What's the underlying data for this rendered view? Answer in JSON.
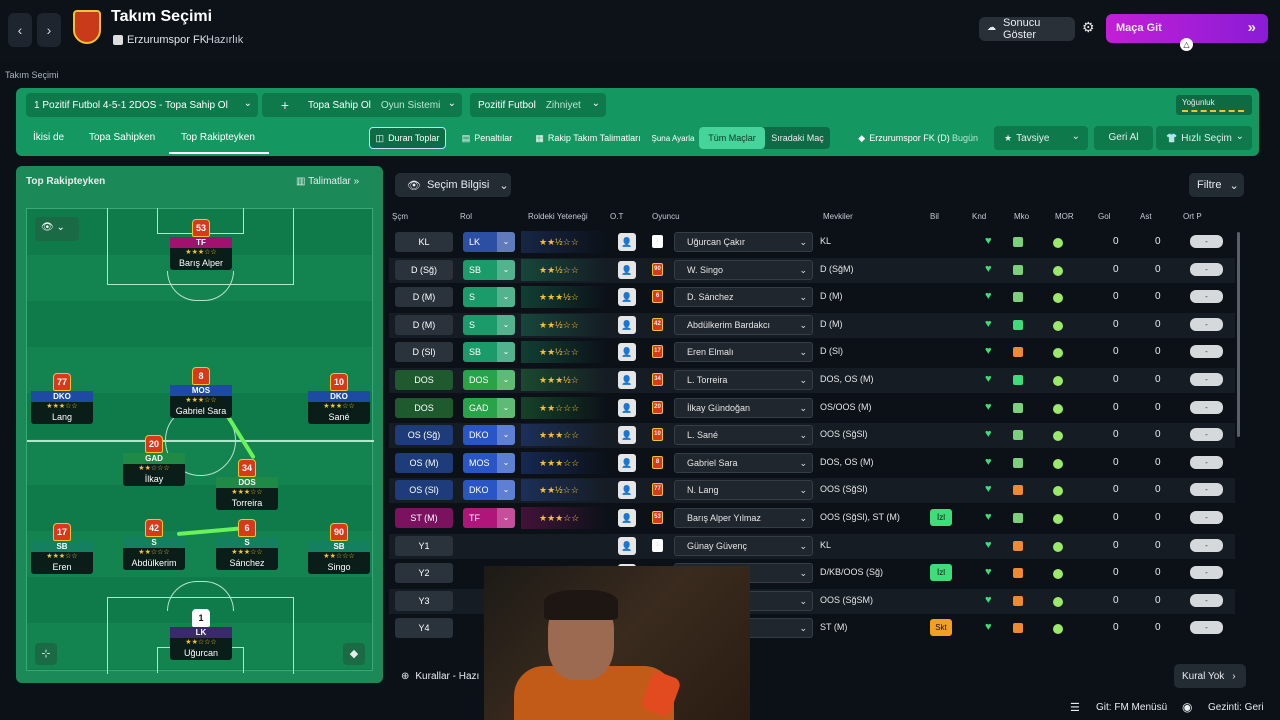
{
  "header": {
    "title": "Takım Seçimi",
    "club": "Erzurumspor FK",
    "mode": "Hazırlık",
    "show_result": "Sonucu Göster",
    "go_match": "Maça Git",
    "section_title": "Takım Seçimi"
  },
  "tactics": {
    "tactic_name": "1  Pozitif Futbol 4-5-1 2DOS - Topa Sahip Ol",
    "ts_label": "Topa Sahip Ol",
    "ts_sub": "Oyun Sistemi",
    "mentality_label": "Pozitif Futbol",
    "mentality_sub": "Zihniyet",
    "intensity": "Yoğunluk",
    "plus": "+"
  },
  "tabs": [
    "İkisi de",
    "Topa Sahipken",
    "Top Rakipteyken"
  ],
  "toolbar": {
    "set_pieces": "Duran Toplar",
    "penalties": "Penaltılar",
    "opp_instr": "Rakip Takım Talimatları",
    "arrange": "Şuna Ayarla",
    "all_matches": "Tüm Maçlar",
    "next_match": "Sıradaki Maç",
    "club_d": "Erzurumspor FK (D)",
    "today": "Bugün",
    "recommend": "Tavsiye",
    "undo": "Geri Al",
    "quick_pick": "Hızlı Seçim"
  },
  "pitch": {
    "title": "Top Rakipteyken",
    "instructions": "Talimatlar",
    "players": [
      {
        "num": "53",
        "pos": "TF",
        "name": "Barış Alper",
        "stars": "★★★☆☆",
        "color": "#a1126e"
      },
      {
        "num": "77",
        "pos": "DKO",
        "name": "Lang",
        "stars": "★★★☆☆",
        "color": "#1d4aa3"
      },
      {
        "num": "8",
        "pos": "MOS",
        "name": "Gabriel Sara",
        "stars": "★★★☆☆",
        "color": "#1d4aa3"
      },
      {
        "num": "10",
        "pos": "DKO",
        "name": "Sané",
        "stars": "★★★☆☆",
        "color": "#1d4aa3"
      },
      {
        "num": "20",
        "pos": "GAD",
        "name": "İlkay",
        "stars": "★★☆☆☆",
        "color": "#1f8a46"
      },
      {
        "num": "34",
        "pos": "DOS",
        "name": "Torreira",
        "stars": "★★★☆☆",
        "color": "#1f8a46"
      },
      {
        "num": "17",
        "pos": "SB",
        "name": "Eren",
        "stars": "★★★☆☆",
        "color": "#14805f"
      },
      {
        "num": "42",
        "pos": "S",
        "name": "Abdülkerim",
        "stars": "★★☆☆☆",
        "color": "#14805f"
      },
      {
        "num": "6",
        "pos": "S",
        "name": "Sánchez",
        "stars": "★★★☆☆",
        "color": "#14805f"
      },
      {
        "num": "90",
        "pos": "SB",
        "name": "Singo",
        "stars": "★★☆☆☆",
        "color": "#14805f"
      },
      {
        "num": "1",
        "pos": "LK",
        "name": "Uğurcan",
        "stars": "★★☆☆☆",
        "color": "#3a2a6a"
      }
    ]
  },
  "table": {
    "select_info": "Seçim Bilgisi",
    "filter": "Filtre",
    "headers": [
      "Şçm",
      "Rol",
      "Roldeki Yeteneği",
      "O.T",
      "Oyuncu",
      "Mevkiler",
      "Bil",
      "Knd",
      "Mko",
      "MOR",
      "Gol",
      "Ast",
      "Ort P"
    ],
    "rows": [
      {
        "sel": "KL",
        "role": "LK",
        "stars": "★★½☆☆",
        "num": "1",
        "name": "Uğurcan Çakır",
        "pos": "KL",
        "bil": "",
        "mko": "#7bd17a",
        "gol": "0",
        "ast": "0",
        "ortp": "-"
      },
      {
        "sel": "D (Sğ)",
        "role": "SB",
        "stars": "★★½☆☆",
        "num": "90",
        "name": "W. Singo",
        "pos": "D (SğM)",
        "bil": "",
        "mko": "#7bd17a",
        "gol": "0",
        "ast": "0",
        "ortp": "-"
      },
      {
        "sel": "D (M)",
        "role": "S",
        "stars": "★★★½☆",
        "num": "6",
        "name": "D. Sánchez",
        "pos": "D (M)",
        "bil": "",
        "mko": "#7bd17a",
        "gol": "0",
        "ast": "0",
        "ortp": "-"
      },
      {
        "sel": "D (M)",
        "role": "S",
        "stars": "★★½☆☆",
        "num": "42",
        "name": "Abdülkerim Bardakcı",
        "pos": "D (M)",
        "bil": "",
        "mko": "#3fdc7a",
        "gol": "0",
        "ast": "0",
        "ortp": "-"
      },
      {
        "sel": "D (Sl)",
        "role": "SB",
        "stars": "★★½☆☆",
        "num": "17",
        "name": "Eren Elmalı",
        "pos": "D (Sl)",
        "bil": "",
        "mko": "#f08a30",
        "gol": "0",
        "ast": "0",
        "ortp": "-"
      },
      {
        "sel": "DOS",
        "role": "DOS",
        "stars": "★★★½☆",
        "num": "34",
        "name": "L. Torreira",
        "pos": "DOS, OS (M)",
        "bil": "",
        "mko": "#3fdc7a",
        "gol": "0",
        "ast": "0",
        "ortp": "-"
      },
      {
        "sel": "DOS",
        "role": "GAD",
        "stars": "★★☆☆☆",
        "num": "20",
        "name": "İlkay Gündoğan",
        "pos": "OS/OOS (M)",
        "bil": "",
        "mko": "#7bd17a",
        "gol": "0",
        "ast": "0",
        "ortp": "-"
      },
      {
        "sel": "OS (Sğ)",
        "role": "DKO",
        "stars": "★★★☆☆",
        "num": "10",
        "name": "L. Sané",
        "pos": "OOS (SğSl)",
        "bil": "",
        "mko": "#7bd17a",
        "gol": "0",
        "ast": "0",
        "ortp": "-"
      },
      {
        "sel": "OS (M)",
        "role": "MOS",
        "stars": "★★★☆☆",
        "num": "8",
        "name": "Gabriel Sara",
        "pos": "DOS, OS (M)",
        "bil": "",
        "mko": "#7bd17a",
        "gol": "0",
        "ast": "0",
        "ortp": "-"
      },
      {
        "sel": "OS (Sl)",
        "role": "DKO",
        "stars": "★★½☆☆",
        "num": "77",
        "name": "N. Lang",
        "pos": "OOS (SğSl)",
        "bil": "",
        "mko": "#f08a30",
        "gol": "0",
        "ast": "0",
        "ortp": "-"
      },
      {
        "sel": "ST (M)",
        "role": "TF",
        "stars": "★★★☆☆",
        "num": "53",
        "name": "Barış Alper Yılmaz",
        "pos": "OOS (SğSl), ST (M)",
        "bil": "İzl",
        "mko": "#7bd17a",
        "gol": "0",
        "ast": "0",
        "ortp": "-"
      },
      {
        "sel": "Y1",
        "role": "",
        "stars": "",
        "num": "1",
        "name": "Günay Güvenç",
        "pos": "KL",
        "bil": "",
        "mko": "#f08a30",
        "gol": "0",
        "ast": "0",
        "ortp": "-"
      },
      {
        "sel": "Y2",
        "role": "",
        "stars": "",
        "num": "",
        "name": "",
        "pos": "D/KB/OOS (Sğ)",
        "bil": "İzl",
        "mko": "#f08a30",
        "gol": "0",
        "ast": "0",
        "ortp": "-"
      },
      {
        "sel": "Y3",
        "role": "",
        "stars": "",
        "num": "",
        "name": "",
        "pos": "OOS (SğSM)",
        "bil": "",
        "mko": "#f08a30",
        "gol": "0",
        "ast": "0",
        "ortp": "-"
      },
      {
        "sel": "Y4",
        "role": "",
        "stars": "",
        "num": "",
        "name": "",
        "pos": "ST (M)",
        "bil": "Skt",
        "mko": "#f08a30",
        "gol": "0",
        "ast": "0",
        "ortp": "-"
      }
    ]
  },
  "footer": {
    "rules": "Kurallar - Hazı",
    "no_rule": "Kural Yok",
    "go_menu": "Git: FM Menüsü",
    "back": "Gezinti: Geri"
  }
}
